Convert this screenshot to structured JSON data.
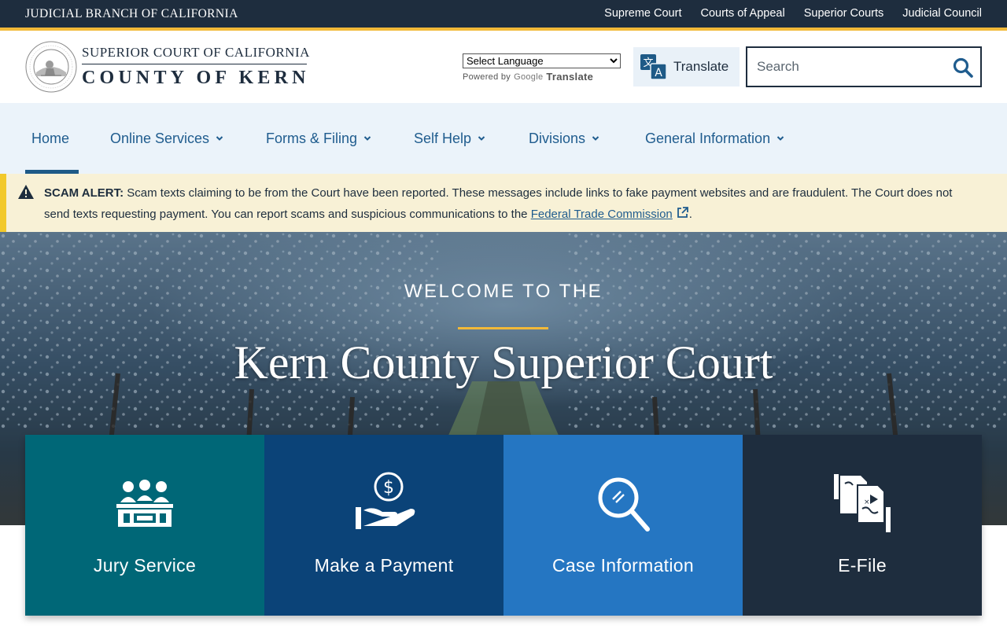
{
  "topbar": {
    "title": "JUDICIAL BRANCH OF CALIFORNIA",
    "links": [
      "Supreme Court",
      "Courts of Appeal",
      "Superior Courts",
      "Judicial Council"
    ]
  },
  "header": {
    "brand_top": "SUPERIOR COURT OF CALIFORNIA",
    "brand_bottom": "COUNTY OF KERN",
    "language_select": "Select Language",
    "powered_by": "Powered by",
    "google_word": "Google",
    "google_translate": "Translate",
    "translate_button": "Translate",
    "search_placeholder": "Search"
  },
  "nav": {
    "items": [
      {
        "label": "Home",
        "dropdown": false,
        "active": true
      },
      {
        "label": "Online Services",
        "dropdown": true
      },
      {
        "label": "Forms & Filing",
        "dropdown": true
      },
      {
        "label": "Self Help",
        "dropdown": true
      },
      {
        "label": "Divisions",
        "dropdown": true
      },
      {
        "label": "General Information",
        "dropdown": true
      }
    ]
  },
  "alert": {
    "title": "SCAM ALERT:",
    "body": " Scam texts claiming to be from the Court have been reported. These messages include links to fake payment websites and are fraudulent. The Court does not send texts requesting payment. You can report scams and suspicious communications to the ",
    "link": "Federal Trade Commission",
    "end": "."
  },
  "hero": {
    "welcome": "WELCOME TO THE",
    "title": "Kern County Superior Court"
  },
  "tiles": [
    {
      "label": "Jury Service",
      "icon": "jury-icon",
      "color": "#006777"
    },
    {
      "label": "Make a Payment",
      "icon": "payment-icon",
      "color": "#0b4378"
    },
    {
      "label": "Case Information",
      "icon": "magnifier-icon",
      "color": "#2576c2"
    },
    {
      "label": "E-File",
      "icon": "efile-icon",
      "color": "#1e2d3e"
    }
  ],
  "colors": {
    "navy": "#1e2d3e",
    "gold": "#f2b938",
    "nav_bg": "#ebf3fa",
    "nav_text": "#1f5c8e",
    "alert_bg": "#f8f1d6"
  }
}
